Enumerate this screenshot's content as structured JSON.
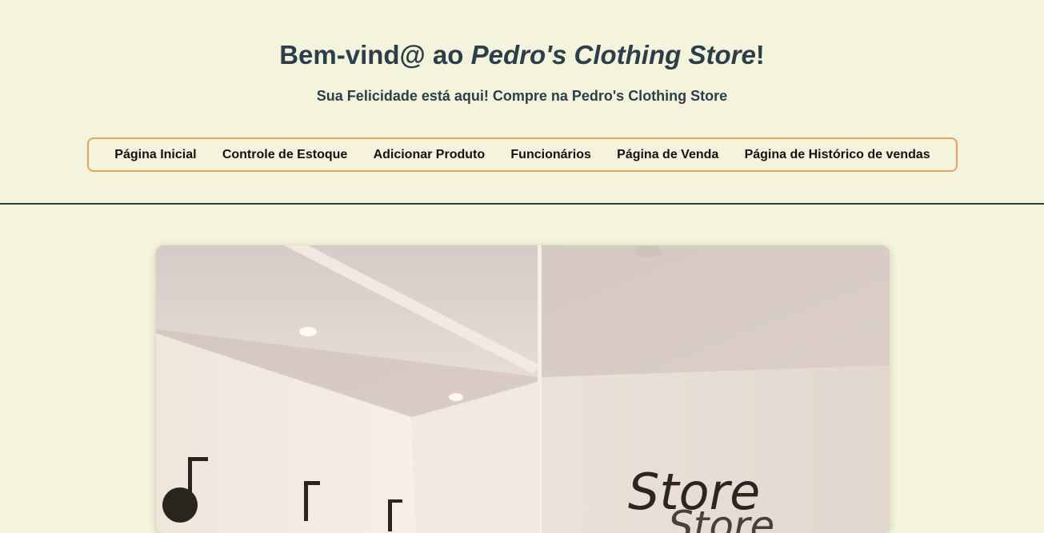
{
  "header": {
    "title_prefix": "Bem-vind@ ao ",
    "title_store": "Pedro's Clothing Store",
    "title_suffix": "!",
    "subtitle": "Sua Felicidade está aqui! Compre na Pedro's Clothing Store"
  },
  "nav": {
    "items": [
      {
        "label": "Página Inicial"
      },
      {
        "label": "Controle de Estoque"
      },
      {
        "label": "Adicionar Produto"
      },
      {
        "label": "Funcionários"
      },
      {
        "label": "Página de Venda"
      },
      {
        "label": "Página de Histórico de vendas"
      }
    ]
  },
  "hero": {
    "sign_text": "Store"
  },
  "colors": {
    "background": "#f4f4dc",
    "text": "#2c3e4a",
    "nav_border": "#eda05c"
  }
}
